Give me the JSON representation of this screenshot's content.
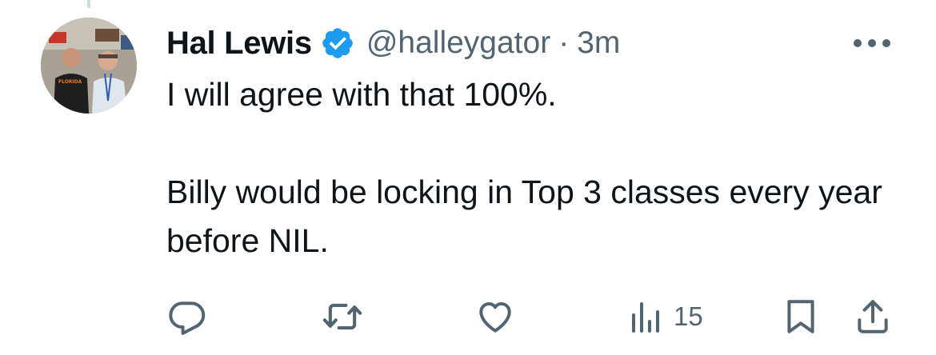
{
  "tweet": {
    "author": {
      "display_name": "Hal Lewis",
      "handle": "@halleygator",
      "verified": true,
      "avatar_shirt_text": "FLORIDA"
    },
    "separator": "·",
    "time": "3m",
    "text_paragraphs": [
      "I will agree with that 100%.",
      "Billy would be locking in Top 3 classes every year before NIL."
    ],
    "actions": {
      "reply": {
        "icon": "reply-icon"
      },
      "retweet": {
        "icon": "retweet-icon"
      },
      "like": {
        "icon": "heart-icon"
      },
      "views": {
        "icon": "views-icon",
        "count": "15"
      },
      "bookmark": {
        "icon": "bookmark-icon"
      },
      "share": {
        "icon": "share-icon"
      }
    }
  },
  "colors": {
    "text": "#0f1419",
    "secondary": "#536471",
    "verified_blue": "#1d9bf0",
    "thread_line": "#cfd9de"
  }
}
